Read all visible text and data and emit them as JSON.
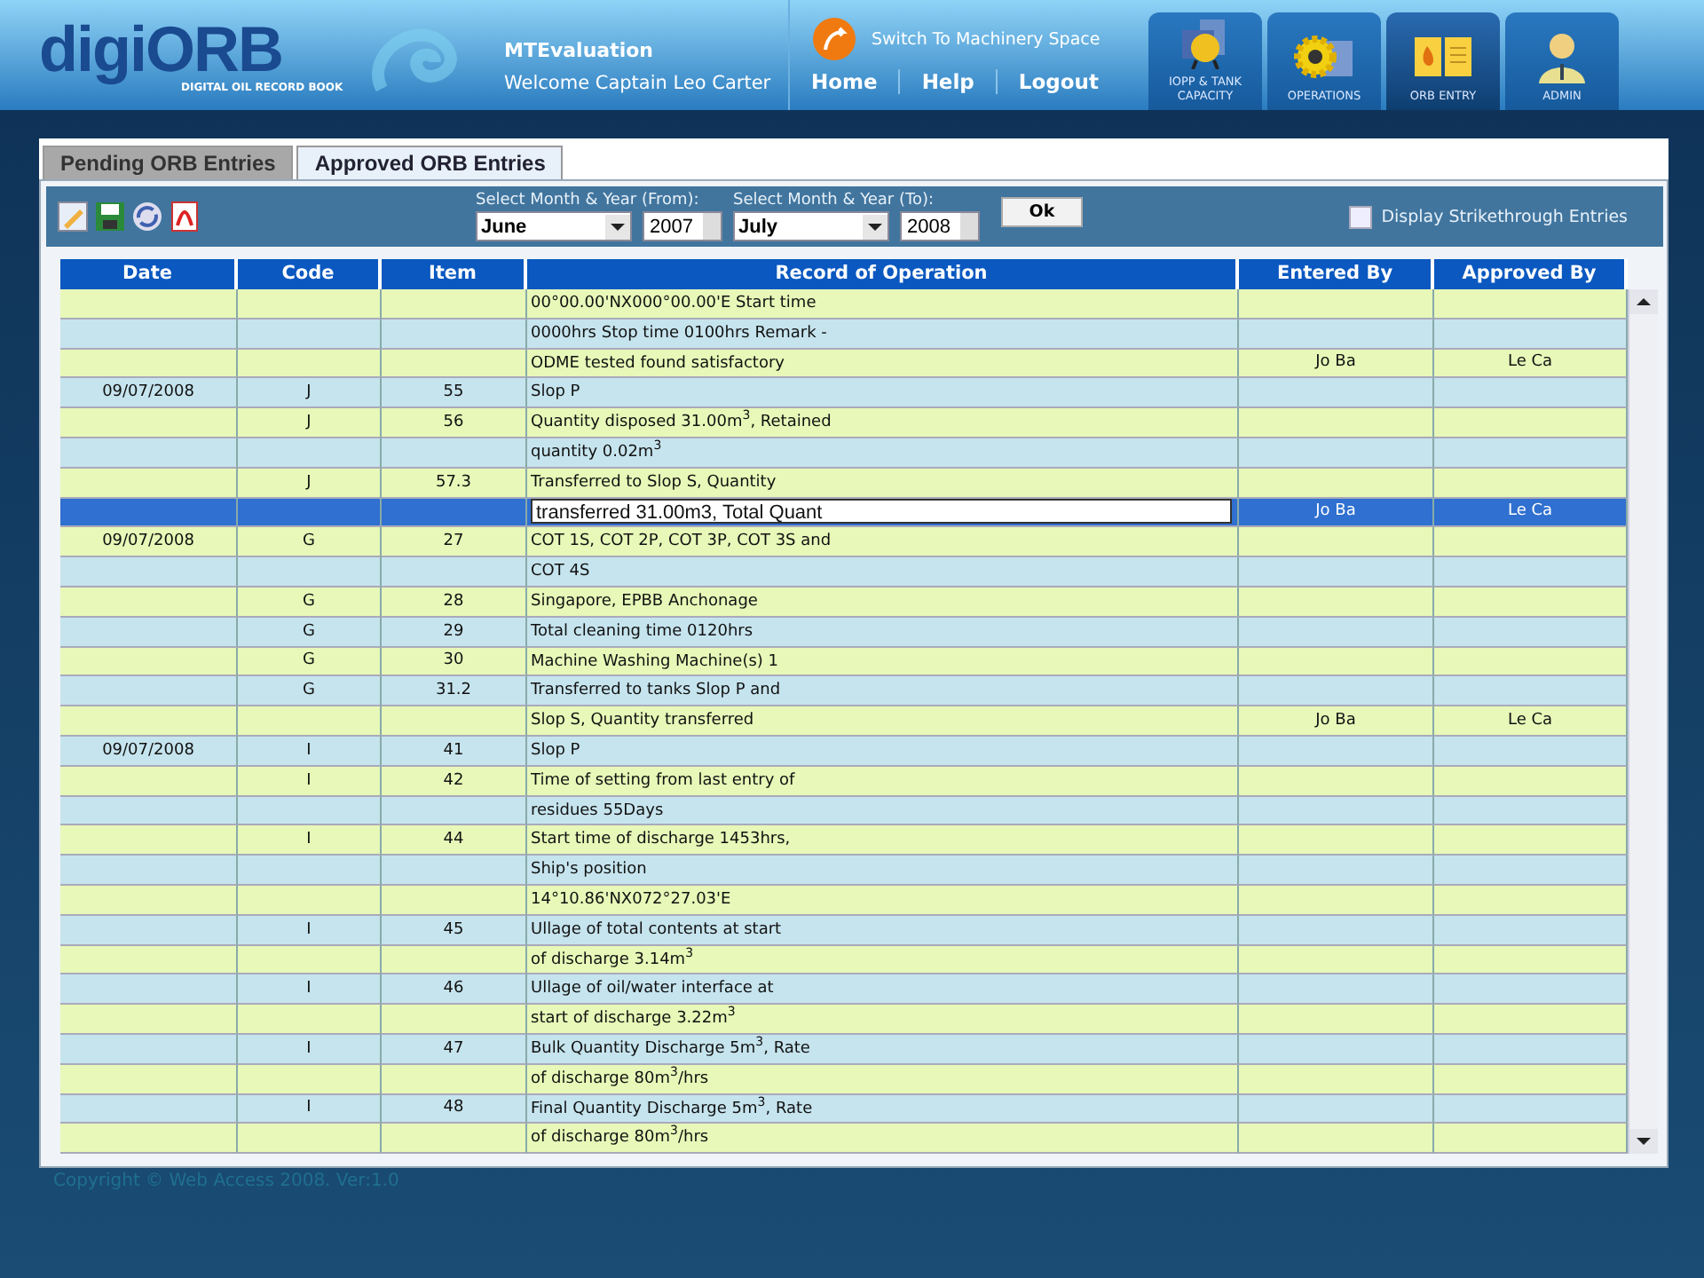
{
  "header": {
    "logo_main": "digiORB",
    "logo_sub": "DIGITAL OIL RECORD BOOK",
    "account": "MTEvaluation",
    "welcome": "Welcome Captain Leo Carter",
    "switch_link": "Switch To Machinery Space",
    "links": [
      "Home",
      "Help",
      "Logout"
    ],
    "modules": [
      {
        "label": "IOPP & TANK CAPACITY",
        "kind": "certificate",
        "selected": false
      },
      {
        "label": "OPERATIONS",
        "kind": "gear",
        "selected": false
      },
      {
        "label": "ORB ENTRY",
        "kind": "book",
        "selected": true
      },
      {
        "label": "ADMIN",
        "kind": "person",
        "selected": false
      }
    ]
  },
  "tabs": [
    {
      "label": "Pending ORB Entries",
      "selected": false
    },
    {
      "label": "Approved ORB Entries",
      "selected": true
    }
  ],
  "filter": {
    "from_label": "Select Month & Year (From):",
    "from_month": "June",
    "from_year": "2007",
    "to_label": "Select Month & Year (To):",
    "to_month": "July",
    "to_year": "2008",
    "ok": "Ok",
    "strike_label": "Display Strikethrough Entries",
    "strike_checked": false
  },
  "toolbar": [
    {
      "kind": "edit"
    },
    {
      "kind": "save"
    },
    {
      "kind": "refresh"
    },
    {
      "kind": "pdf"
    }
  ],
  "table": {
    "columns": [
      "Date",
      "Code",
      "Item",
      "Record of Operation",
      "Entered By",
      "Approved By"
    ],
    "rows": [
      {
        "date": "",
        "code": "",
        "item": "",
        "record": "00°00.00'NX000°00.00'E Start time",
        "entered": "",
        "approved": "",
        "selected": false
      },
      {
        "date": "",
        "code": "",
        "item": "",
        "record": "0000hrs Stop time 0100hrs Remark -",
        "entered": "",
        "approved": "",
        "selected": false
      },
      {
        "date": "",
        "code": "",
        "item": "",
        "record": "ODME tested found satisfactory",
        "entered": "Jo Ba",
        "approved": "Le Ca",
        "selected": false
      },
      {
        "date": "09/07/2008",
        "code": "J",
        "item": "55",
        "record": "Slop P",
        "entered": "",
        "approved": "",
        "selected": false
      },
      {
        "date": "",
        "code": "J",
        "item": "56",
        "record": "Quantity disposed 31.00m$^{3}$, Retained",
        "entered": "",
        "approved": "",
        "selected": false
      },
      {
        "date": "",
        "code": "",
        "item": "",
        "record": "quantity 0.02m$^{3}$",
        "entered": "",
        "approved": "",
        "selected": false
      },
      {
        "date": "",
        "code": "J",
        "item": "57.3",
        "record": "Transferred to Slop S, Quantity",
        "entered": "",
        "approved": "",
        "selected": false
      },
      {
        "date": "",
        "code": "",
        "item": "",
        "record": "transferred 31.00m3, Total Quant",
        "entered": "Jo Ba",
        "approved": "Le Ca",
        "selected": true
      },
      {
        "date": "09/07/2008",
        "code": "G",
        "item": "27",
        "record": "COT 1S, COT 2P, COT 3P, COT 3S and",
        "entered": "",
        "approved": "",
        "selected": false
      },
      {
        "date": "",
        "code": "",
        "item": "",
        "record": "COT 4S",
        "entered": "",
        "approved": "",
        "selected": false
      },
      {
        "date": "",
        "code": "G",
        "item": "28",
        "record": "Singapore, EPBB Anchonage",
        "entered": "",
        "approved": "",
        "selected": false
      },
      {
        "date": "",
        "code": "G",
        "item": "29",
        "record": "Total cleaning time 0120hrs",
        "entered": "",
        "approved": "",
        "selected": false
      },
      {
        "date": "",
        "code": "G",
        "item": "30",
        "record": "Machine Washing Machine(s) 1",
        "entered": "",
        "approved": "",
        "selected": false
      },
      {
        "date": "",
        "code": "G",
        "item": "31.2",
        "record": "Transferred to tanks Slop P and",
        "entered": "",
        "approved": "",
        "selected": false
      },
      {
        "date": "",
        "code": "",
        "item": "",
        "record": "Slop S, Quantity transferred",
        "entered": "Jo Ba",
        "approved": "Le Ca",
        "selected": false
      },
      {
        "date": "09/07/2008",
        "code": "I",
        "item": "41",
        "record": "Slop P",
        "entered": "",
        "approved": "",
        "selected": false
      },
      {
        "date": "",
        "code": "I",
        "item": "42",
        "record": "Time of setting from last entry of",
        "entered": "",
        "approved": "",
        "selected": false
      },
      {
        "date": "",
        "code": "",
        "item": "",
        "record": "residues 55Days",
        "entered": "",
        "approved": "",
        "selected": false
      },
      {
        "date": "",
        "code": "I",
        "item": "44",
        "record": "Start time of discharge 1453hrs,",
        "entered": "",
        "approved": "",
        "selected": false
      },
      {
        "date": "",
        "code": "",
        "item": "",
        "record": "Ship's position",
        "entered": "",
        "approved": "",
        "selected": false
      },
      {
        "date": "",
        "code": "",
        "item": "",
        "record": "14°10.86'NX072°27.03'E",
        "entered": "",
        "approved": "",
        "selected": false
      },
      {
        "date": "",
        "code": "I",
        "item": "45",
        "record": "Ullage of total contents at start",
        "entered": "",
        "approved": "",
        "selected": false
      },
      {
        "date": "",
        "code": "",
        "item": "",
        "record": "of discharge 3.14m$^{3}$",
        "entered": "",
        "approved": "",
        "selected": false
      },
      {
        "date": "",
        "code": "I",
        "item": "46",
        "record": "Ullage of oil/water interface at",
        "entered": "",
        "approved": "",
        "selected": false
      },
      {
        "date": "",
        "code": "",
        "item": "",
        "record": "start of discharge 3.22m$^{3}$",
        "entered": "",
        "approved": "",
        "selected": false
      },
      {
        "date": "",
        "code": "I",
        "item": "47",
        "record": "Bulk Quantity Discharge 5m$^{3}$, Rate",
        "entered": "",
        "approved": "",
        "selected": false
      },
      {
        "date": "",
        "code": "",
        "item": "",
        "record": "of discharge 80m$^{3}$/hrs",
        "entered": "",
        "approved": "",
        "selected": false
      },
      {
        "date": "",
        "code": "I",
        "item": "48",
        "record": "Final Quantity Discharge 5m$^{3}$, Rate",
        "entered": "",
        "approved": "",
        "selected": false
      },
      {
        "date": "",
        "code": "",
        "item": "",
        "record": "of discharge 80m$^{3}$/hrs",
        "entered": "",
        "approved": "",
        "selected": false
      }
    ]
  },
  "footer": "Copyright © Web Access 2008. Ver:1.0"
}
